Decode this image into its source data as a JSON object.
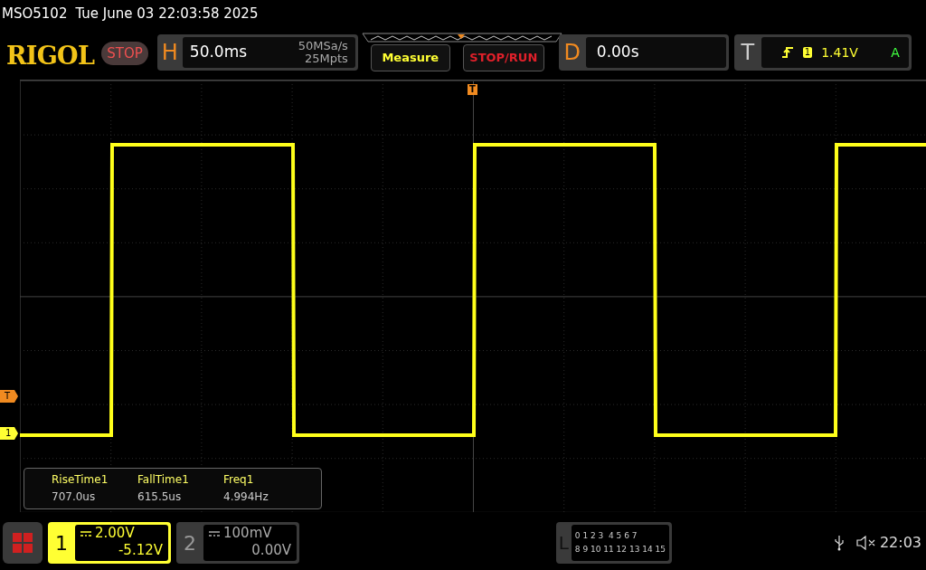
{
  "header": {
    "model": "MSO5102",
    "datetime": "Tue June 03 22:03:58 2025"
  },
  "logo": "RIGOL",
  "run_state": {
    "label": "STOP",
    "stopped": true
  },
  "horizontal": {
    "label": "H",
    "timebase": "50.0ms",
    "sample_rate": "50MSa/s",
    "memory": "25Mpts"
  },
  "buttons": [
    {
      "label": "Measure",
      "kind": "measure"
    },
    {
      "label": "STOP/RUN",
      "kind": "run"
    }
  ],
  "delay": {
    "label": "D",
    "value": "0.00s"
  },
  "trigger": {
    "label": "T",
    "source": "1",
    "level": "1.41V",
    "mode": "A"
  },
  "markers": {
    "trigger_position": "T",
    "trigger_level": "T",
    "channel": "1"
  },
  "measurements": [
    {
      "name": "RiseTime1",
      "value": "707.0us"
    },
    {
      "name": "FallTime1",
      "value": "615.5us"
    },
    {
      "name": "Freq1",
      "value": "4.994Hz"
    }
  ],
  "channels": [
    {
      "number": "1",
      "scale": "2.00V",
      "offset": "-5.12V",
      "selected": true
    },
    {
      "number": "2",
      "scale": "100mV",
      "offset": "0.00V",
      "selected": false
    }
  ],
  "logic": {
    "label": "L",
    "rows": [
      "0 1 2 3  4 5 6 7",
      "8 9 10 11 12 13 14 15"
    ]
  },
  "clock": "22:03"
}
